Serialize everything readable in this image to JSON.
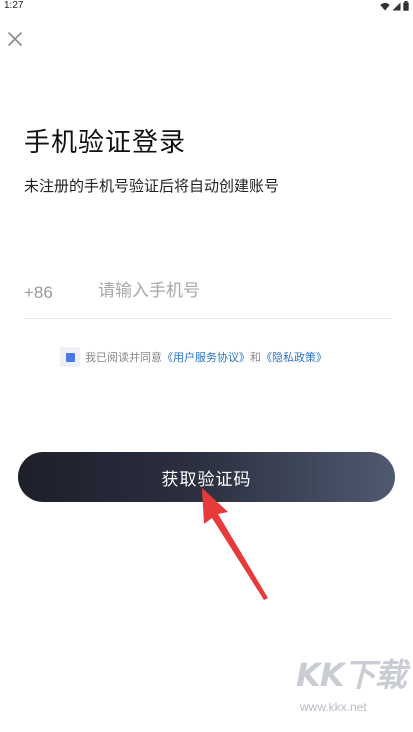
{
  "status_bar": {
    "time": "1:27",
    "icons": [
      "wifi-icon",
      "signal-icon",
      "battery-icon"
    ]
  },
  "header": {
    "close_icon": "close-icon"
  },
  "main": {
    "title": "手机验证登录",
    "subtitle": "未注册的手机号验证后将自动创建账号",
    "phone": {
      "country_code": "+86",
      "value": "",
      "placeholder": "请输入手机号"
    },
    "agreement": {
      "checked": true,
      "prefix": "我已阅读并同意",
      "user_agreement": "《用户服务协议》",
      "conjunction": "和",
      "privacy_policy": "《隐私政策》"
    },
    "submit_label": "获取验证码"
  },
  "watermark": {
    "logo": "KK下载",
    "url": "www.kkx.net"
  },
  "colors": {
    "link": "#2b73c8",
    "checkbox": "#4a78e8",
    "button_start": "#1e1f2b",
    "button_end": "#4e5a70",
    "arrow": "#e83a3a"
  }
}
